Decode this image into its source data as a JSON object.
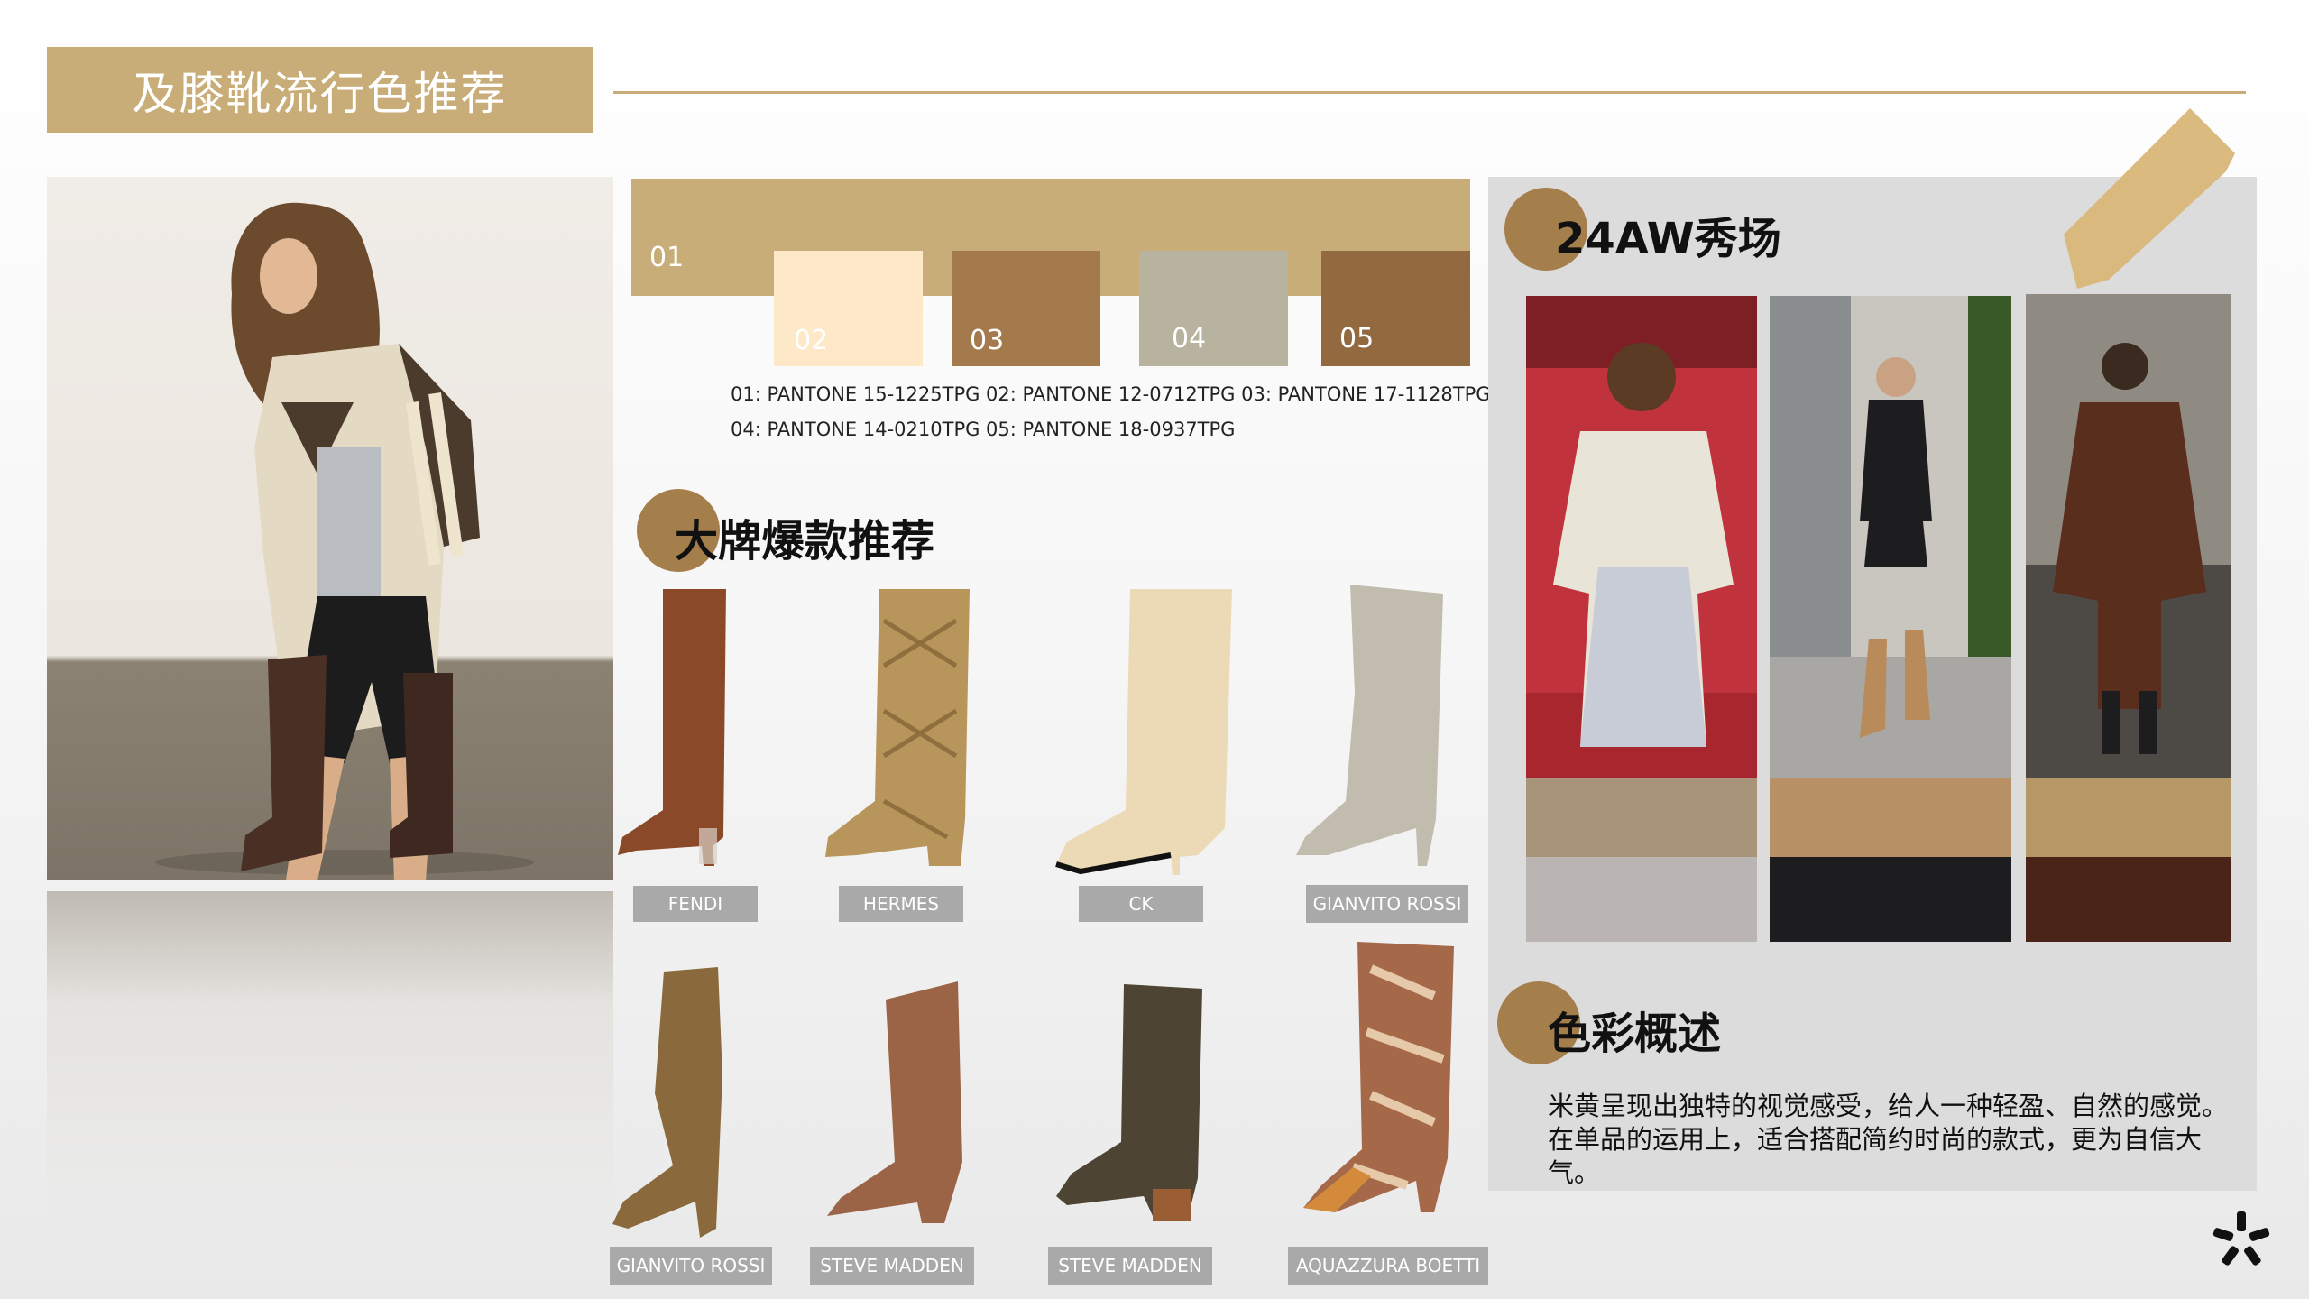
{
  "header": {
    "title": "及膝靴流行色推荐"
  },
  "swatches": [
    {
      "label": "01",
      "color": "#c9ad78"
    },
    {
      "label": "02",
      "color": "#fde9c8"
    },
    {
      "label": "03",
      "color": "#a47a4d"
    },
    {
      "label": "04",
      "color": "#b8b39f"
    },
    {
      "label": "05",
      "color": "#936a3f"
    }
  ],
  "pantone": {
    "line1": "01: PANTONE 15-1225TPG   02: PANTONE 12-0712TPG  03: PANTONE 17-1128TPG",
    "line2": "04: PANTONE 14-0210TPG  05: PANTONE 18-0937TPG"
  },
  "brands_section": {
    "title": "大牌爆款推荐"
  },
  "boots": [
    {
      "brand": "FENDI",
      "color": "#8a4a2a",
      "style": "stiletto"
    },
    {
      "brand": "HERMES",
      "color": "#b8955a",
      "style": "quilted"
    },
    {
      "brand": "CK",
      "color": "#ecd9b6",
      "style": "kitten"
    },
    {
      "brand": "GIANVITO ROSSI",
      "color": "#c2bcae",
      "style": "slouch"
    },
    {
      "brand": "GIANVITO ROSSI",
      "color": "#8a6a3c",
      "style": "slouch-suede"
    },
    {
      "brand": "STEVE MADDEN",
      "color": "#9b6447",
      "style": "pointed"
    },
    {
      "brand": "STEVE MADDEN",
      "color": "#4d4434",
      "style": "western"
    },
    {
      "brand": "AQUAZZURA BOETTI",
      "color": "#a5694a",
      "style": "snake"
    }
  ],
  "runway_section": {
    "title": "24AW秀场"
  },
  "runway_palettes": [
    [
      "#a89479",
      "#bab4b3"
    ],
    [
      "#b99167",
      "#1d1d1f"
    ],
    [
      "#b69766",
      "#4a2418"
    ]
  ],
  "color_overview": {
    "title": "色彩概述",
    "text": "米黄呈现出独特的视觉感受，给人一种轻盈、自然的感觉。在单品的运用上，适合搭配简约时尚的款式，更为自信大气。"
  },
  "colors": {
    "accent": "#c9ad78",
    "accent_dark": "#a47f4c",
    "label_gray": "#a9a9a9"
  }
}
